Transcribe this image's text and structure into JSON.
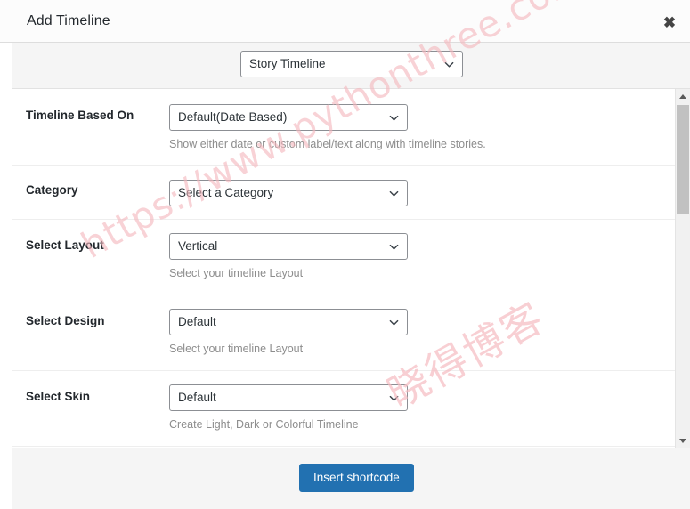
{
  "dialog": {
    "title": "Add Timeline",
    "close_label": "✖",
    "close_icon": "close-icon"
  },
  "top_strip": {
    "select": {
      "value": "Story Timeline",
      "icon": "chevron-down-icon"
    }
  },
  "form": {
    "rows": [
      {
        "label": "Timeline Based On",
        "value": "Default(Date Based)",
        "description": "Show either date or custom label/text along with timeline stories.",
        "name": "timeline-based-on"
      },
      {
        "label": "Category",
        "value": "Select a Category",
        "description": "",
        "name": "category"
      },
      {
        "label": "Select Layout",
        "value": "Vertical",
        "description": "Select your timeline Layout",
        "name": "select-layout"
      },
      {
        "label": "Select Design",
        "value": "Default",
        "description": "Select your timeline Layout",
        "name": "select-design"
      },
      {
        "label": "Select Skin",
        "value": "Default",
        "description": "Create Light, Dark or Colorful Timeline",
        "name": "select-skin"
      }
    ]
  },
  "footer": {
    "primary_button": "Insert shortcode"
  },
  "scrollbar": {
    "up_icon": "arrow-up-icon",
    "down_icon": "arrow-down-icon"
  },
  "watermark": {
    "url": "https://www.pythonthree.com",
    "site": "晓得博客"
  },
  "colors": {
    "primary": "#2271b1",
    "header_bg": "#fcfcfc",
    "strip_bg": "#f5f5f5",
    "footer_bg": "#f5f5f5",
    "watermark": "#f4b8be"
  }
}
